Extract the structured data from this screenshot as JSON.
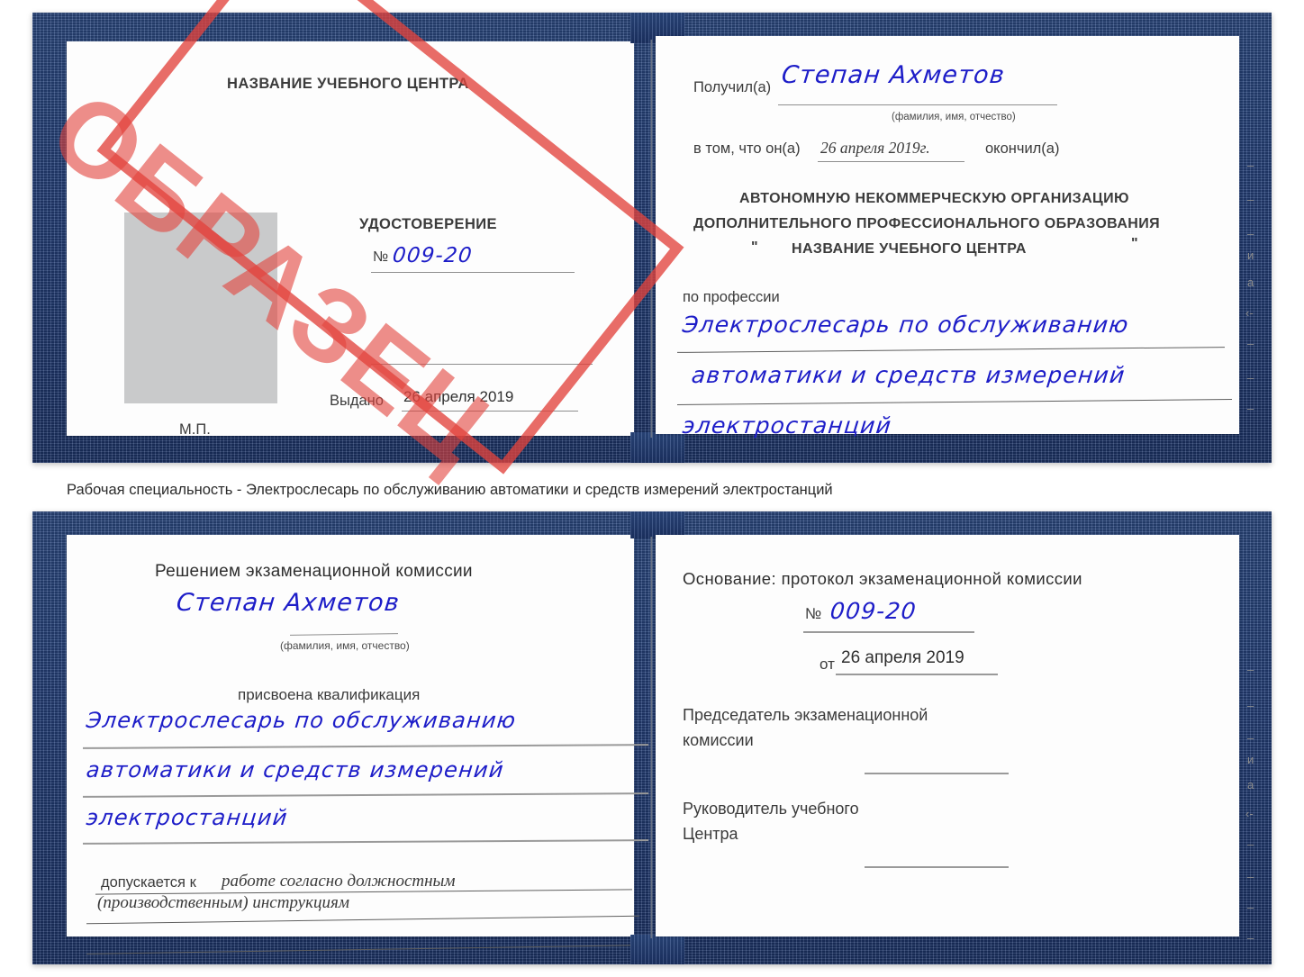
{
  "document": {
    "type": "certificate-scan",
    "watermark": {
      "text": "ОБРАЗЕЦ",
      "color": "#e2423c"
    },
    "ink_color": "#1d1dc8",
    "cover_color": "#24407a"
  },
  "caption": {
    "text": "Рабочая специальность - Электрослесарь по обслуживанию автоматики и средств измерений электростанций"
  },
  "cert_top": {
    "left_page": {
      "center_name": "НАЗВАНИЕ УЧЕБНОГО ЦЕНТРА",
      "doc_title": "УДОСТОВЕРЕНИЕ",
      "number_label": "№",
      "number_value": "009-20",
      "issued_label": "Выдано",
      "issued_value": "26 апреля 2019",
      "stamp_label": "М.П.",
      "photo_placeholder": "photo-area"
    },
    "right_page": {
      "received_label": "Получил(а)",
      "received_value": "Степан Ахметов",
      "fio_hint": "(фамилия, имя, отчество)",
      "in_that_label": "в том, что он(а)",
      "in_that_value": "26 апреля 2019г.",
      "finished_label": "окончил(а)",
      "org_line1": "АВТОНОМНУЮ НЕКОММЕРЧЕСКУЮ ОРГАНИЗАЦИЮ",
      "org_line2": "ДОПОЛНИТЕЛЬНОГО ПРОФЕССИОНАЛЬНОГО ОБРАЗОВАНИЯ",
      "org_quote_open": "\"",
      "org_line3": "НАЗВАНИЕ УЧЕБНОГО ЦЕНТРА",
      "org_quote_close": "\"",
      "profession_label": "по профессии",
      "profession_line1": "Электрослесарь по обслуживанию",
      "profession_line2": "автоматики и средств измерений",
      "profession_line3": "электростанций"
    },
    "margin_artifacts": [
      "–",
      "–",
      "–",
      "и",
      "а",
      "‹-",
      "–",
      "–",
      "–",
      "–"
    ]
  },
  "cert_bottom": {
    "left_page": {
      "heading": "Решением экзаменационной комиссии",
      "name_value": "Степан Ахметов",
      "fio_hint": "(фамилия, имя, отчество)",
      "qualification_label": "присвоена квалификация",
      "qualification_line1": "Электрослесарь по обслуживанию",
      "qualification_line2": "автоматики и средств измерений",
      "qualification_line3": "электростанций",
      "admitted_label": "допускается к",
      "admitted_value_line1": "работе согласно должностным",
      "admitted_value_line2": "(производственным) инструкциям"
    },
    "right_page": {
      "basis_label": "Основание: протокол экзаменационной комиссии",
      "number_label": "№",
      "number_value": "009-20",
      "date_label": "от",
      "date_value": "26 апреля 2019",
      "chair_line1": "Председатель экзаменационной",
      "chair_line2": "комиссии",
      "head_line1": "Руководитель учебного",
      "head_line2": "Центра"
    },
    "margin_artifacts": [
      "–",
      "–",
      "–",
      "и",
      "а",
      "‹-",
      "–",
      "–",
      "–",
      "–"
    ]
  }
}
